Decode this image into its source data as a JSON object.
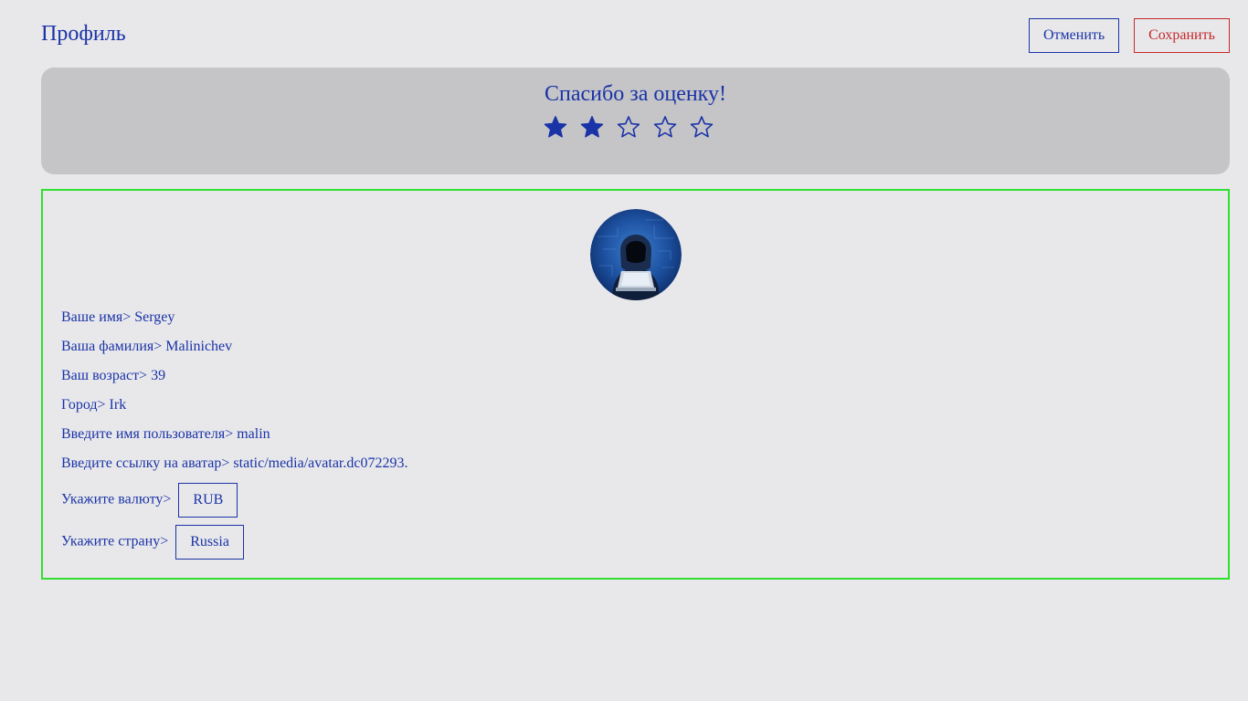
{
  "header": {
    "title": "Профиль",
    "cancel_label": "Отменить",
    "save_label": "Сохранить"
  },
  "rating": {
    "title": "Спасибо за оценку!",
    "value": 2,
    "max": 5,
    "star_icon": "star-icon"
  },
  "profile": {
    "avatar_icon": "hooded-figure-laptop-avatar",
    "fields": [
      {
        "label": "Ваше имя>",
        "value": "Sergey"
      },
      {
        "label": "Ваша фамилия>",
        "value": "Malinichev"
      },
      {
        "label": "Ваш возраст>",
        "value": "39"
      },
      {
        "label": "Город>",
        "value": "Irk"
      },
      {
        "label": "Введите имя пользователя>",
        "value": "malin"
      },
      {
        "label": "Введите ссылку на аватар>",
        "value": "static/media/avatar.dc072293."
      }
    ],
    "currency": {
      "label": "Укажите валюту>",
      "value": "RUB"
    },
    "country": {
      "label": "Укажите страну>",
      "value": "Russia"
    }
  },
  "colors": {
    "background": "#e8e8eb",
    "accent": "#1a33a6",
    "danger": "#c62828",
    "panel": "#c5c5c8",
    "frame": "#2fe02f"
  }
}
